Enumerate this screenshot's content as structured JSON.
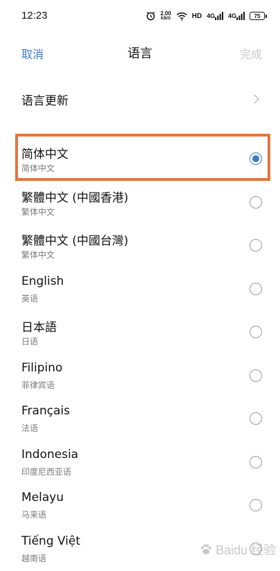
{
  "status_bar": {
    "time": "12:23",
    "speed_value": "2.00",
    "speed_unit": "KB/S",
    "hd_label": "HD",
    "sig1": "4G",
    "sig2": "4G",
    "battery": "75"
  },
  "nav": {
    "cancel_label": "取消",
    "title": "语言",
    "done_label": "完成"
  },
  "update": {
    "label": "语言更新"
  },
  "languages": [
    {
      "name": "简体中文",
      "sub": "简体中文",
      "selected": true
    },
    {
      "name": "繁體中文 (中國香港)",
      "sub": "繁体中文",
      "selected": false
    },
    {
      "name": "繁體中文 (中國台灣)",
      "sub": "繁体中文",
      "selected": false
    },
    {
      "name": "English",
      "sub": "英语",
      "selected": false
    },
    {
      "name": "日本語",
      "sub": "日语",
      "selected": false
    },
    {
      "name": "Filipino",
      "sub": "菲律宾语",
      "selected": false
    },
    {
      "name": "Français",
      "sub": "法语",
      "selected": false
    },
    {
      "name": "Indonesia",
      "sub": "印度尼西亚语",
      "selected": false
    },
    {
      "name": "Melayu",
      "sub": "马来语",
      "selected": false
    },
    {
      "name": "Tiếng Việt",
      "sub": "越南语",
      "selected": false
    }
  ],
  "watermark": {
    "text": "Baidu 经验"
  },
  "colors": {
    "accent": "#3b7ac6",
    "highlight": "#e2763f",
    "disabled": "#c9c9c9"
  },
  "icons": [
    "alarm-icon",
    "wifi-icon",
    "signal-icon",
    "battery-icon",
    "chevron-right-icon",
    "radio-icon"
  ]
}
